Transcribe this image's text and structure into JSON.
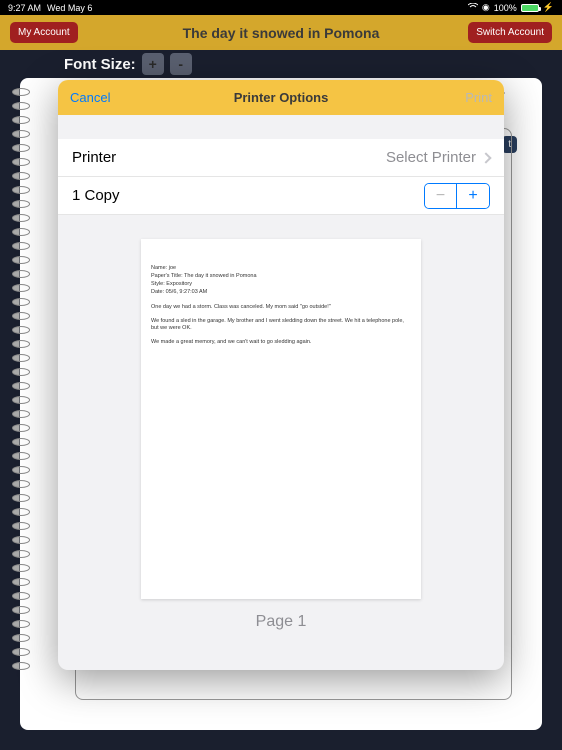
{
  "status": {
    "time": "9:27 AM",
    "date": "Wed May 6",
    "battery": "100%"
  },
  "app": {
    "title": "The day it snowed in Pomona",
    "my_account": "My Account",
    "switch_account": "Switch Account"
  },
  "font": {
    "label": "Font Size:",
    "plus": "+",
    "minus": "-"
  },
  "modal": {
    "cancel": "Cancel",
    "title": "Printer Options",
    "print": "Print",
    "printer_label": "Printer",
    "printer_value": "Select Printer",
    "copies_label": "1 Copy"
  },
  "preview": {
    "name_line": "Name: joe",
    "title_line": "Paper's Title: The day it snowed in Pomona",
    "style_line": "Style: Expository",
    "date_line": "Date: 05/6, 9:27:03 AM",
    "para1": "One day we had a storm. Class was canceled. My mom said \"go outside!\"",
    "para2": "We found a sled in the garage. My brother and I went sledding down the street. We hit a telephone pole, but we were OK.",
    "para3": "We made a great memory, and we can't wait to go sledding again.",
    "page_label": "Page 1"
  }
}
